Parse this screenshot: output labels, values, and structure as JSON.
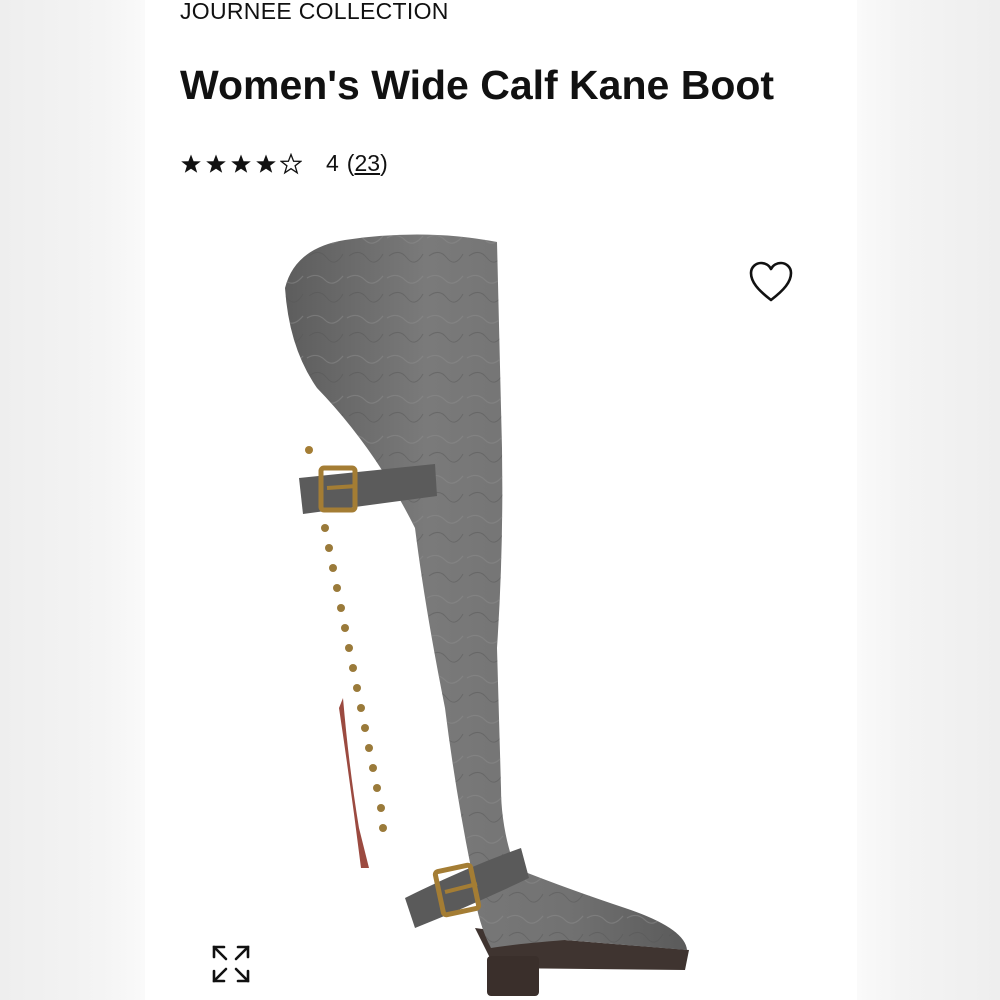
{
  "product": {
    "brand": "JOURNEE COLLECTION",
    "title": "Women's Wide Calf Kane Boot",
    "rating": {
      "stars_filled": 4,
      "stars_total": 5,
      "value": "4",
      "review_count": "23",
      "open_paren": "(",
      "close_paren": ")"
    },
    "image": {
      "subject": "grey over-the-knee boot with brass buckles and studs"
    }
  },
  "icons": {
    "favorite": "heart-outline-icon",
    "expand": "expand-arrows-icon"
  },
  "colors": {
    "text": "#111111",
    "boot": "#6f6f6f",
    "hardware": "#9a7a3a"
  }
}
